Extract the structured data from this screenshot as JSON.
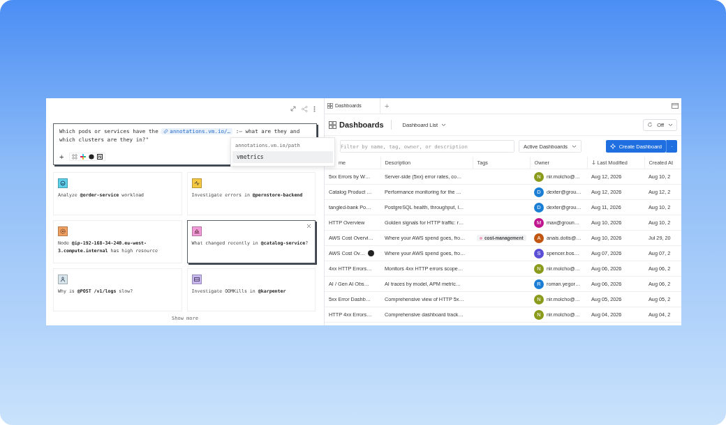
{
  "composer": {
    "text_before": "Which pods or services have the",
    "chip": "annotations.vm.io/…",
    "text_after": ":— what are they and which clusters are they in?\"",
    "add_label": "+"
  },
  "suggestion_menu": {
    "header": "annotations.vm.io/path",
    "items": [
      {
        "label": "vmetrics",
        "selected": true
      }
    ]
  },
  "cards": [
    {
      "text": "Analyze **@order-service** workload",
      "color": "#5bd0e8",
      "selected": false
    },
    {
      "text": "Investigate errors in **@pernstore-backend**",
      "color": "#f5c842",
      "selected": false
    },
    {
      "text": "Node **@ip-192-168-34-240.eu-west-3.compute.internal** has high resource",
      "color": "#f0a060",
      "selected": false
    },
    {
      "text": "What changed recently in **@catalog-service**?",
      "color": "#f09ad8",
      "selected": true
    },
    {
      "text": "Why is **@POST /v1/logs** slow?",
      "color": "#d8e6ec",
      "selected": false
    },
    {
      "text": "Investigate OOMKills in **@karpenter**",
      "color": "#c8b8f0",
      "selected": false
    }
  ],
  "show_more": "Show more",
  "tabs": [
    {
      "label": "Dashboards",
      "selected": true
    }
  ],
  "new_tab": "+",
  "header": {
    "title": "Dashboards",
    "view": "Dashboard List",
    "refresh": "Off"
  },
  "filter": {
    "placeholder": "Filter by name, tag, owner, or description"
  },
  "status_filter": "Active Dashboards",
  "create_button": "Create Dashboard",
  "table": {
    "columns": [
      {
        "label": "me",
        "sorted": false
      },
      {
        "label": "Description",
        "sorted": false
      },
      {
        "label": "Tags",
        "sorted": false
      },
      {
        "label": "Owner",
        "sorted": false
      },
      {
        "label": "Last Modified",
        "sorted": true
      },
      {
        "label": "Created At",
        "sorted": false
      }
    ],
    "rows": [
      {
        "name": "5xx Errors by W…",
        "badge": false,
        "description": "Server-side (5xx) error rates, co…",
        "tags": [],
        "owner": "nir.molcho@…",
        "initial": "N",
        "color": "#8a9a1a",
        "modified": "Aug 12, 2026",
        "created": "Aug 10, 2"
      },
      {
        "name": "Catalog Product …",
        "badge": false,
        "description": "Performance monitoring for the …",
        "tags": [],
        "owner": "dexter@grou…",
        "initial": "D",
        "color": "#1a7fd4",
        "modified": "Aug 12, 2026",
        "created": "Aug 12, 2"
      },
      {
        "name": "tangled-bank Po…",
        "badge": false,
        "description": "PostgreSQL health, throughput, l…",
        "tags": [],
        "owner": "dexter@grou…",
        "initial": "D",
        "color": "#1a7fd4",
        "modified": "Aug 11, 2026",
        "created": "Aug 10, 2"
      },
      {
        "name": "HTTP Overview",
        "badge": false,
        "description": "Golden signals for HTTP traffic: r…",
        "tags": [],
        "owner": "max@groun…",
        "initial": "M",
        "color": "#c0158f",
        "modified": "Aug 10, 2026",
        "created": "Aug 10, 2"
      },
      {
        "name": "AWS Cost Overvi…",
        "badge": false,
        "description": "Where your AWS spend goes, fro…",
        "tags": [
          {
            "label": "cost-management",
            "color": "#f2a0c0"
          }
        ],
        "owner": "anais.dotis@…",
        "initial": "A",
        "color": "#c0560f",
        "modified": "Aug 10, 2026",
        "created": "Jul 29, 20"
      },
      {
        "name": "AWS Cost Ov…",
        "badge": true,
        "description": "Where your AWS spend goes, fro…",
        "tags": [],
        "owner": "spencer.bos…",
        "initial": "S",
        "color": "#5b4fd6",
        "modified": "Aug 07, 2026",
        "created": "Aug 07, 2"
      },
      {
        "name": "4xx HTTP Errors…",
        "badge": false,
        "description": "Monitors 4xx HTTP errors scope…",
        "tags": [],
        "owner": "nir.molcho@…",
        "initial": "N",
        "color": "#8a9a1a",
        "modified": "Aug 06, 2026",
        "created": "Aug 06, 2"
      },
      {
        "name": "AI / Gen AI Obs…",
        "badge": false,
        "description": "AI traces by model, APM metric…",
        "tags": [],
        "owner": "roman.yegor…",
        "initial": "R",
        "color": "#1a7fd4",
        "modified": "Aug 06, 2026",
        "created": "Aug 06, 2"
      },
      {
        "name": "5xx Error Dashb…",
        "badge": false,
        "description": "Comprehensive view of HTTP 5x…",
        "tags": [],
        "owner": "nir.molcho@…",
        "initial": "N",
        "color": "#8a9a1a",
        "modified": "Aug 05, 2026",
        "created": "Aug 05, 2"
      },
      {
        "name": "HTTP 4xx Errors…",
        "badge": false,
        "description": "Comprehensive dashboard track…",
        "tags": [],
        "owner": "nir.molcho@…",
        "initial": "N",
        "color": "#8a9a1a",
        "modified": "Aug 04, 2026",
        "created": "Aug 04, 2"
      }
    ]
  }
}
